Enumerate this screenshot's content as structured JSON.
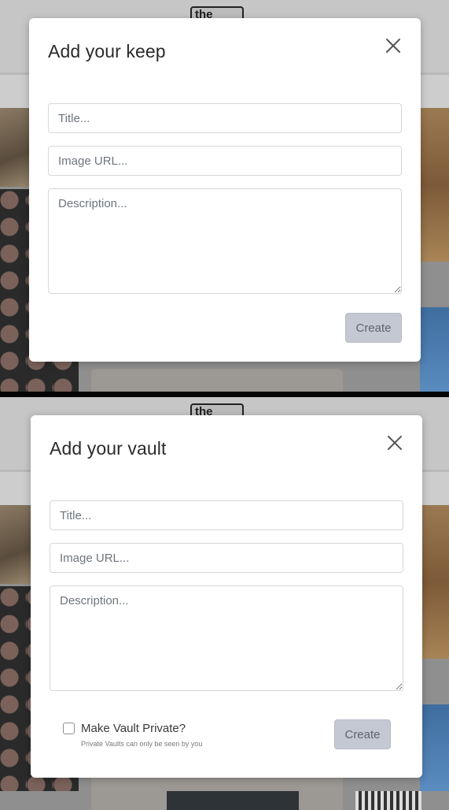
{
  "background": {
    "logo_text": "the"
  },
  "keep_modal": {
    "title": "Add your keep",
    "title_placeholder": "Title...",
    "image_url_placeholder": "Image URL...",
    "description_placeholder": "Description...",
    "create_label": "Create"
  },
  "vault_modal": {
    "title": "Add your vault",
    "title_placeholder": "Title...",
    "image_url_placeholder": "Image URL...",
    "description_placeholder": "Description...",
    "private_label": "Make Vault Private?",
    "private_hint": "Private Vaults can only be seen by you",
    "private_checked": false,
    "create_label": "Create"
  },
  "icons": {
    "close": "close-icon"
  },
  "colors": {
    "button_disabled_bg": "#c3c8d2",
    "input_border": "#d4d7db",
    "overlay": "#8f8f8f"
  }
}
